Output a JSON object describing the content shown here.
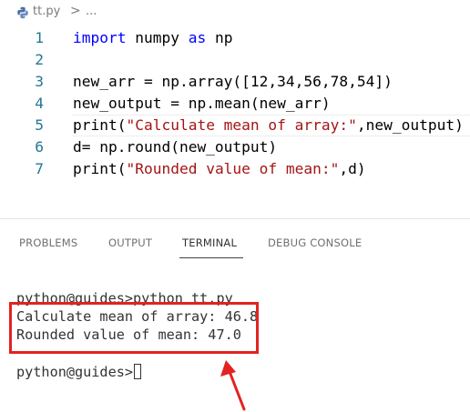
{
  "breadcrumb": {
    "file": "tt.py",
    "separator": ">",
    "ellipsis": "...",
    "icon": "python-file-icon"
  },
  "editor": {
    "lines": [
      {
        "number": "1",
        "tokens": [
          {
            "t": "import",
            "c": "kw"
          },
          {
            "t": " numpy ",
            "c": ""
          },
          {
            "t": "as",
            "c": "kw"
          },
          {
            "t": " np",
            "c": ""
          }
        ]
      },
      {
        "number": "2",
        "tokens": []
      },
      {
        "number": "3",
        "tokens": [
          {
            "t": "new_arr = np.array([12,34,56,78,54])",
            "c": ""
          }
        ]
      },
      {
        "number": "4",
        "tokens": [
          {
            "t": "new_output = np.mean(new_arr)",
            "c": ""
          }
        ]
      },
      {
        "number": "5",
        "tokens": [
          {
            "t": "print(",
            "c": ""
          },
          {
            "t": "\"Calculate mean of array:\"",
            "c": "str"
          },
          {
            "t": ",new_output)",
            "c": ""
          }
        ],
        "current": true
      },
      {
        "number": "6",
        "tokens": [
          {
            "t": "d= np.round(new_output)",
            "c": ""
          }
        ]
      },
      {
        "number": "7",
        "tokens": [
          {
            "t": "print(",
            "c": ""
          },
          {
            "t": "\"Rounded value of mean:\"",
            "c": "str"
          },
          {
            "t": ",d)",
            "c": ""
          }
        ]
      }
    ]
  },
  "panel": {
    "tabs": [
      {
        "label": "PROBLEMS",
        "active": false
      },
      {
        "label": "OUTPUT",
        "active": false
      },
      {
        "label": "TERMINAL",
        "active": true
      },
      {
        "label": "DEBUG CONSOLE",
        "active": false
      }
    ]
  },
  "terminal": {
    "command_line": "python@guides>python tt.py",
    "output_lines": [
      "Calculate mean of array: 46.8",
      "Rounded value of mean: 47.0"
    ],
    "prompt": "python@guides>"
  },
  "colors": {
    "annotation": "#e32222",
    "keyword": "#0000ff",
    "string": "#a31515",
    "line_number": "#237893"
  }
}
